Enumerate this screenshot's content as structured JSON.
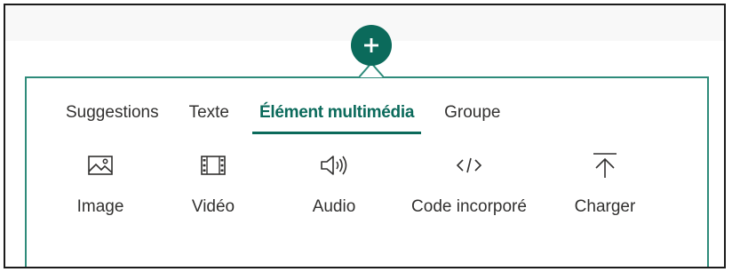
{
  "add_button": {
    "icon": "plus-icon",
    "color": "#0b6a5b"
  },
  "tabs": [
    {
      "label": "Suggestions",
      "active": false
    },
    {
      "label": "Texte",
      "active": false
    },
    {
      "label": "Élément multimédia",
      "active": true
    },
    {
      "label": "Groupe",
      "active": false
    }
  ],
  "media_items": [
    {
      "label": "Image",
      "icon": "image-icon"
    },
    {
      "label": "Vidéo",
      "icon": "video-icon"
    },
    {
      "label": "Audio",
      "icon": "audio-icon"
    },
    {
      "label": "Code incorporé",
      "icon": "code-icon"
    },
    {
      "label": "Charger",
      "icon": "upload-icon"
    }
  ],
  "colors": {
    "accent": "#0b6a5b",
    "panel_border": "#2e8b7a",
    "text": "#323130"
  }
}
